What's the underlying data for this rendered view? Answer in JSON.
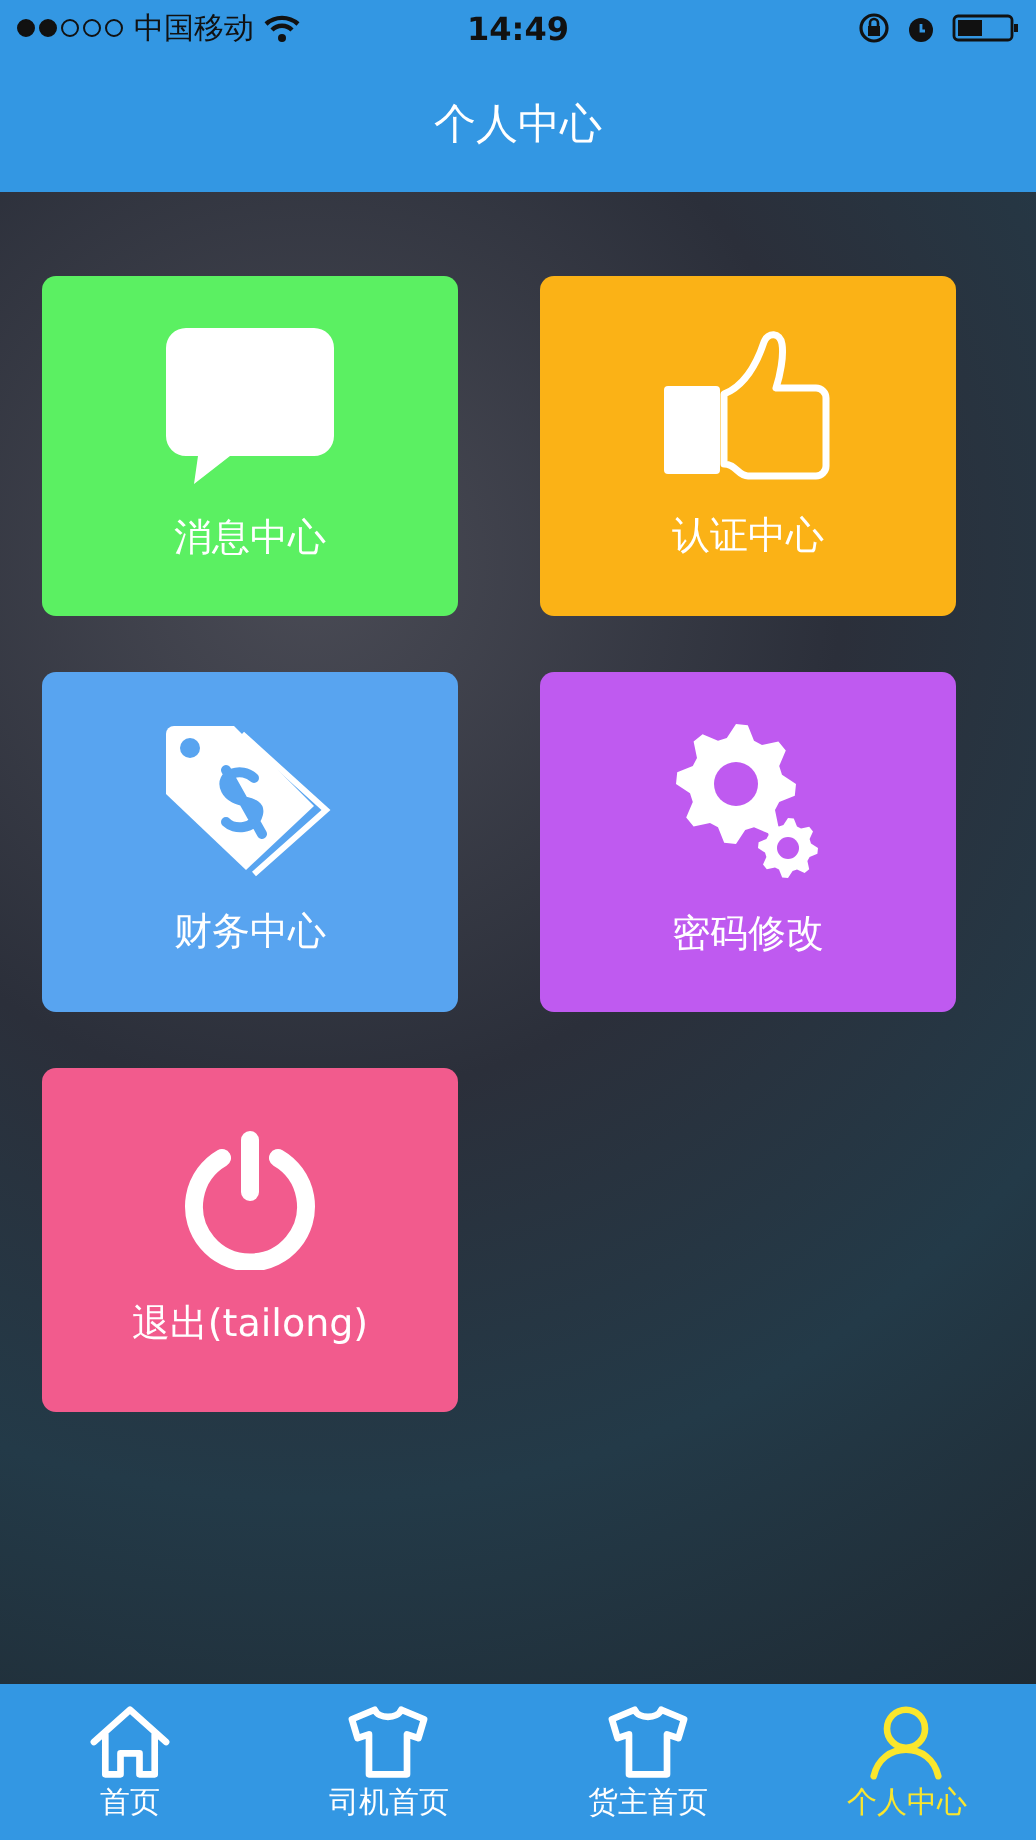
{
  "status_bar": {
    "carrier": "中国移动",
    "time": "14:49"
  },
  "header": {
    "title": "个人中心"
  },
  "tiles": [
    {
      "kind": "message",
      "label": "消息中心",
      "color": "#5bf062"
    },
    {
      "kind": "verify",
      "label": "认证中心",
      "color": "#fbb216"
    },
    {
      "kind": "finance",
      "label": "财务中心",
      "color": "#58a4f0"
    },
    {
      "kind": "password",
      "label": "密码修改",
      "color": "#bf5af0"
    },
    {
      "kind": "logout",
      "label": "退出(tailong)",
      "color": "#f25b8d"
    }
  ],
  "tab_bar": [
    {
      "kind": "home",
      "label": "首页",
      "selected": false
    },
    {
      "kind": "shirt",
      "label": "司机首页",
      "selected": false
    },
    {
      "kind": "shirt",
      "label": "货主首页",
      "selected": false
    },
    {
      "kind": "person",
      "label": "个人中心",
      "selected": true
    }
  ]
}
